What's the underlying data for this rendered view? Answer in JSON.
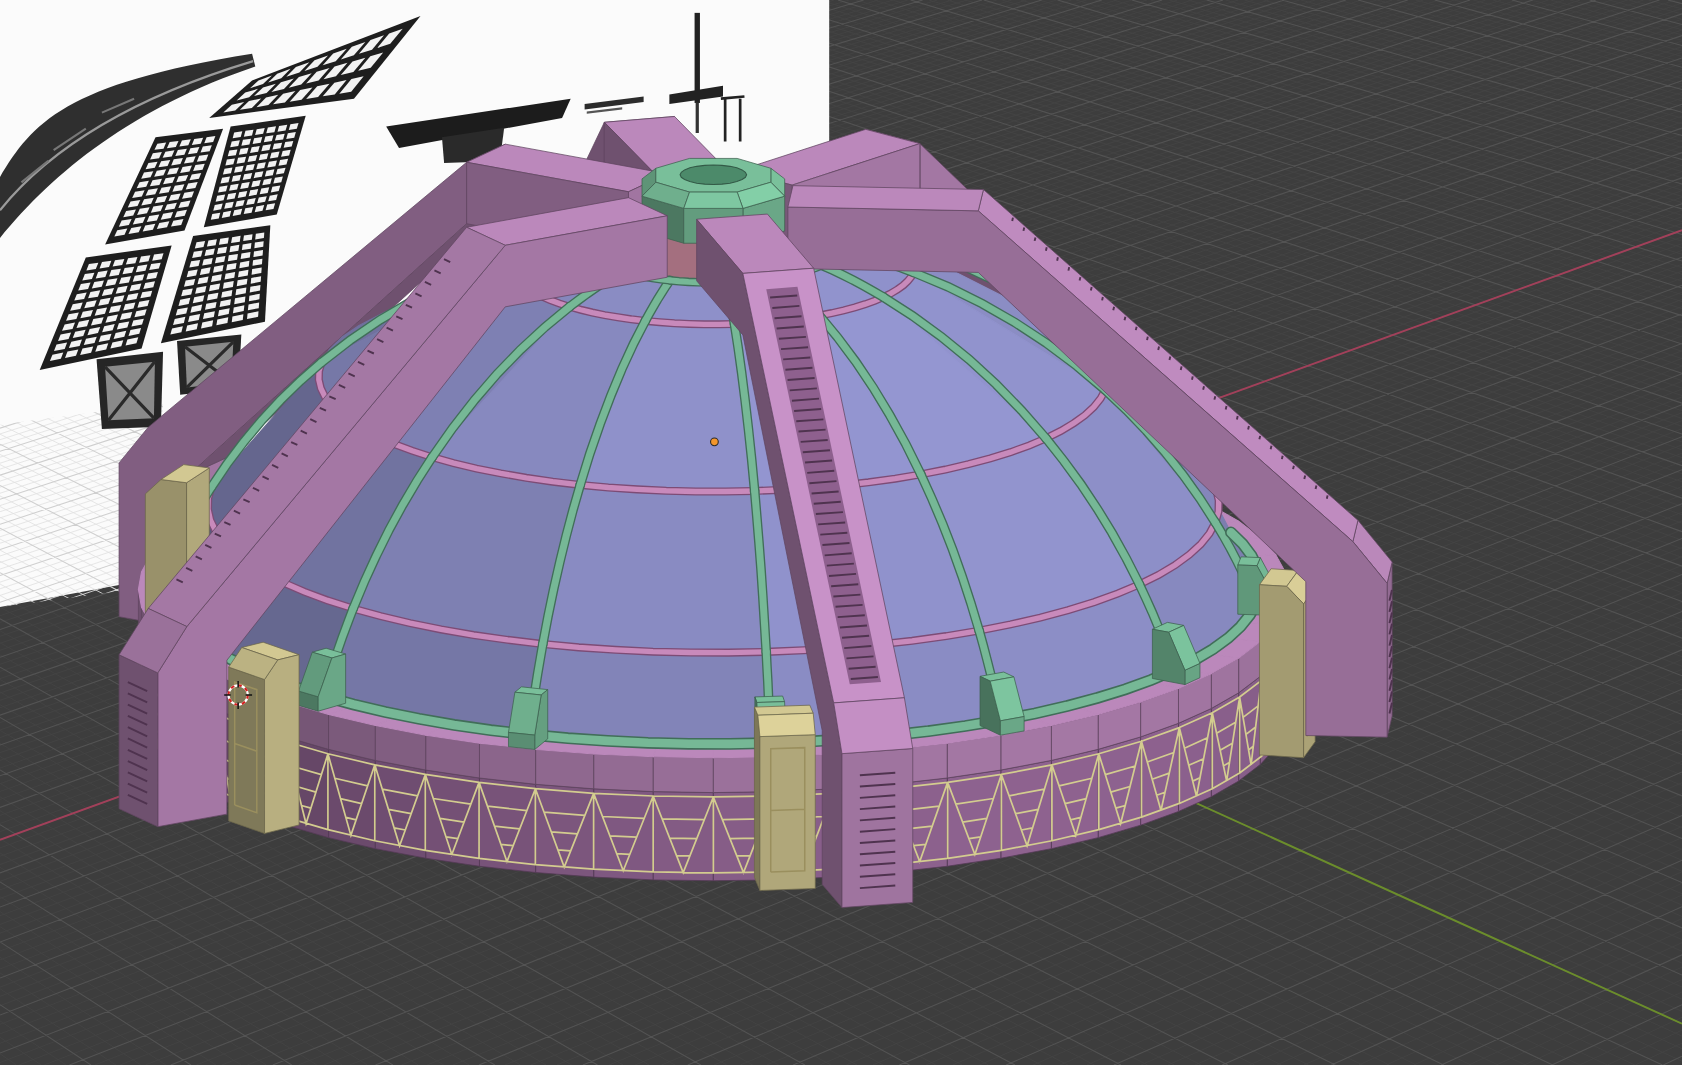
{
  "viewport": {
    "axes": [
      {
        "kind": "x",
        "color": "#a2405a"
      },
      {
        "kind": "y",
        "color": "#6b8d2b"
      }
    ]
  }
}
